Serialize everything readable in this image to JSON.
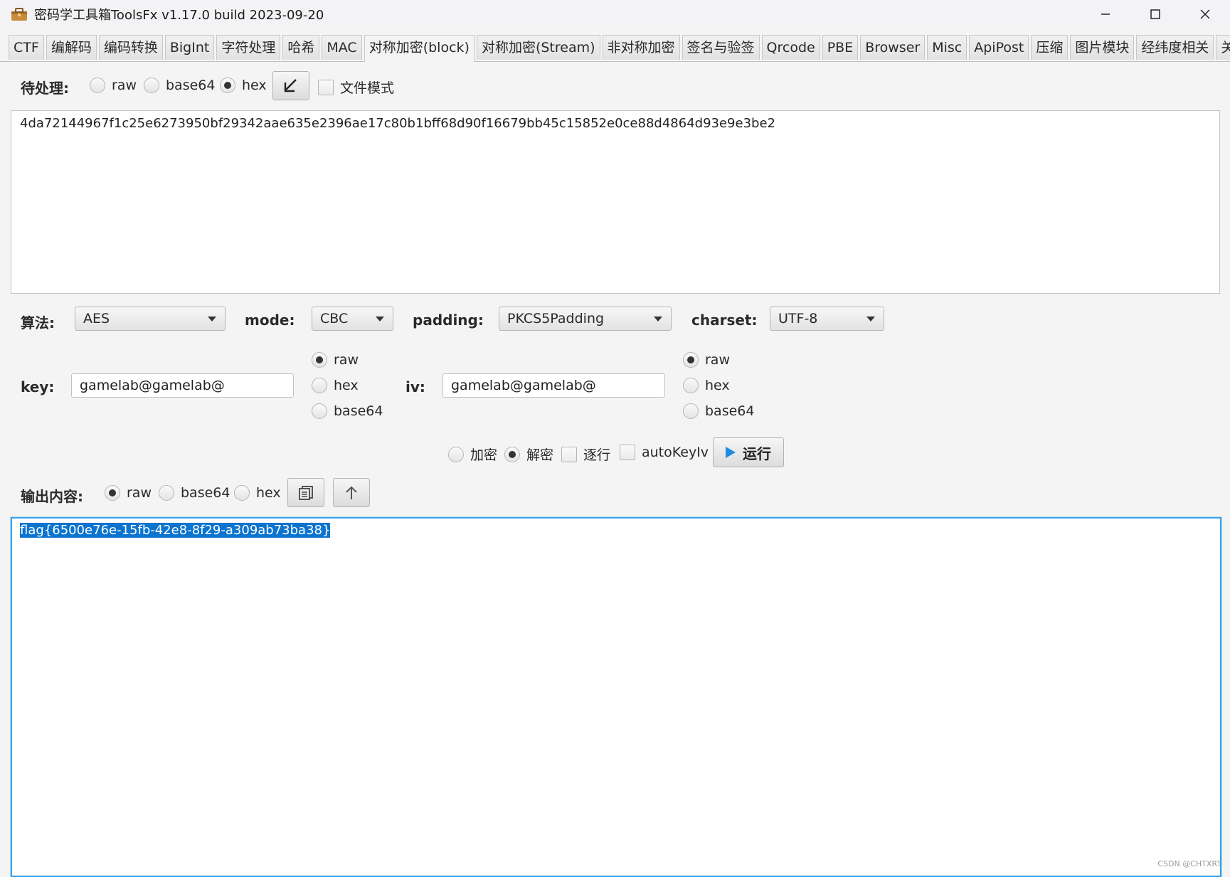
{
  "window": {
    "title": "密码学工具箱ToolsFx v1.17.0 build 2023-09-20",
    "app_icon": "toolbox-icon",
    "controls": [
      "minimize-icon",
      "maximize-icon",
      "close-icon"
    ]
  },
  "tabs": [
    {
      "label": "CTF",
      "active": false
    },
    {
      "label": "编解码",
      "active": false
    },
    {
      "label": "编码转换",
      "active": false
    },
    {
      "label": "BigInt",
      "active": false
    },
    {
      "label": "字符处理",
      "active": false
    },
    {
      "label": "哈希",
      "active": false
    },
    {
      "label": "MAC",
      "active": false
    },
    {
      "label": "对称加密(block)",
      "active": true
    },
    {
      "label": "对称加密(Stream)",
      "active": false
    },
    {
      "label": "非对称加密",
      "active": false
    },
    {
      "label": "签名与验签",
      "active": false
    },
    {
      "label": "Qrcode",
      "active": false
    },
    {
      "label": "PBE",
      "active": false
    },
    {
      "label": "Browser",
      "active": false
    },
    {
      "label": "Misc",
      "active": false
    },
    {
      "label": "ApiPost",
      "active": false
    },
    {
      "label": "压缩",
      "active": false
    },
    {
      "label": "图片模块",
      "active": false
    },
    {
      "label": "经纬度相关",
      "active": false
    },
    {
      "label": "关于",
      "active": false
    }
  ],
  "input_section": {
    "label": "待处理:",
    "encodings": [
      "raw",
      "base64",
      "hex"
    ],
    "selected_encoding": "hex",
    "file_mode_label": "文件模式",
    "file_mode_checked": false,
    "text": "4da72144967f1c25e6273950bf29342aae635e2396ae17c80b1bff68d90f16679bb45c15852e0ce88d4864d93e9e3be2"
  },
  "params": {
    "algorithm_label": "算法:",
    "algorithm": "AES",
    "mode_label": "mode:",
    "mode": "CBC",
    "padding_label": "padding:",
    "padding": "PKCS5Padding",
    "charset_label": "charset:",
    "charset": "UTF-8"
  },
  "key": {
    "label": "key:",
    "value": "gamelab@gamelab@",
    "encodings": [
      "raw",
      "hex",
      "base64"
    ],
    "selected_encoding": "raw"
  },
  "iv": {
    "label": "iv:",
    "value": "gamelab@gamelab@",
    "encodings": [
      "raw",
      "hex",
      "base64"
    ],
    "selected_encoding": "raw"
  },
  "actions": {
    "encrypt_label": "加密",
    "decrypt_label": "解密",
    "selected_action": "decrypt",
    "line_by_line_label": "逐行",
    "auto_key_iv_label": "autoKeyIv",
    "run_label": "运行"
  },
  "output_section": {
    "label": "输出内容:",
    "encodings": [
      "raw",
      "base64",
      "hex"
    ],
    "selected_encoding": "raw",
    "text": "flag{6500e76e-15fb-42e8-8f29-a309ab73ba38}"
  },
  "watermark": "CSDN @CHTXRT",
  "colors": {
    "accent": "#3aa1e6",
    "selection": "#0b74cf",
    "run_icon": "#1f8ce0"
  }
}
